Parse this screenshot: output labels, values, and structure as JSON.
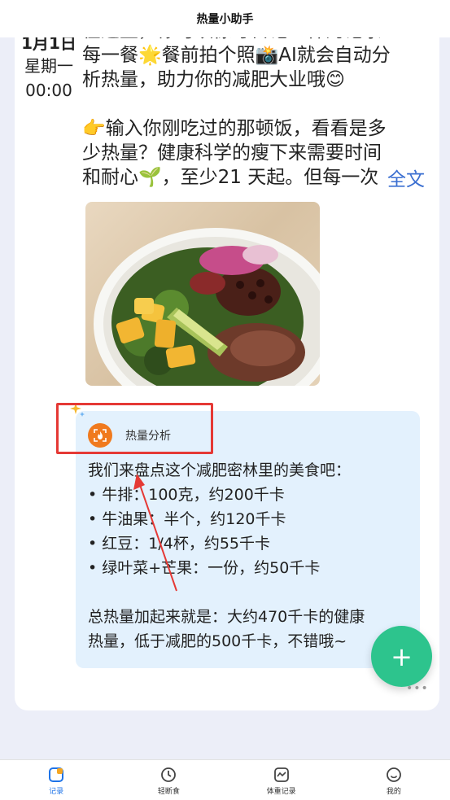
{
  "header": {
    "title": "热量小助手"
  },
  "entry": {
    "date": "1月1日",
    "weekday": "星期一",
    "time": "00:00",
    "text_lines": [
      "在这里，你可以像写日记一样的记录",
      "每一餐🌟餐前拍个照📸AI就会自动分",
      "析热量，助力你的减肥大业哦😊",
      "👉输入你刚吃过的那顿饭，看看是多",
      "少热量？健康科学的瘦下来需要时间",
      "和耐心🌱，至少21 天起。但每一次"
    ],
    "expand_label": "全文"
  },
  "analysis": {
    "title": "热量分析",
    "intro": "我们来盘点这个减肥密林里的美食吧：",
    "items": [
      "• 牛排：100克，约200千卡",
      "• 牛油果：半个，约120千卡",
      "• 红豆：1/4杯，约55千卡",
      "• 绿叶菜+芒果：一份，约50千卡"
    ],
    "summary_lines": [
      "总热量加起来就是：大约470千卡的健康",
      "热量，低于减肥的500千卡，不错哦~"
    ]
  },
  "fab": {
    "label": "+"
  },
  "more": {
    "label": "•••"
  },
  "nav": [
    {
      "label": "记录",
      "icon": "record-icon",
      "active": true
    },
    {
      "label": "轻断食",
      "icon": "clock-icon",
      "active": false
    },
    {
      "label": "体重记录",
      "icon": "scale-icon",
      "active": false
    },
    {
      "label": "我的",
      "icon": "smile-icon",
      "active": false
    }
  ],
  "colors": {
    "accent_blue": "#1e73e8",
    "fab_green": "#2dc48d",
    "analysis_bg": "#e3f1fd",
    "annotation_red": "#e53935",
    "analysis_icon_orange": "#f07a1e"
  }
}
